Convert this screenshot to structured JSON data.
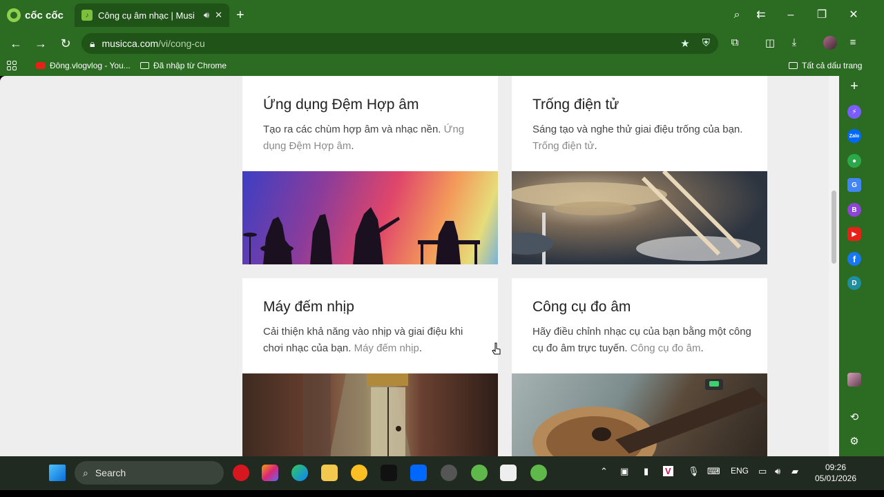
{
  "browser": {
    "brand": "cốc cốc",
    "tab_title": "Công cụ âm nhạc | Musi",
    "url_host": "musicca.com",
    "url_path": "/vi/cong-cu",
    "bookmarks": [
      {
        "label": "Đông.vlogvlog - You...",
        "icon": "youtube-icon"
      },
      {
        "label": "Đã nhập từ Chrome",
        "icon": "folder-icon"
      }
    ],
    "all_bookmarks": "Tất cả dấu trang"
  },
  "cards": [
    {
      "title": "Ứng dụng Đệm Hợp âm",
      "desc": "Tạo ra các chùm hợp âm và nhạc nền.",
      "link": "Ứng dụng Đệm Hợp âm"
    },
    {
      "title": "Trống điện tử",
      "desc": "Sáng tạo và nghe thử giai điệu trống của bạn.",
      "link": "Trống điện tử"
    },
    {
      "title": "Máy đếm nhịp",
      "desc": "Cải thiện khả năng vào nhịp và giai điệu khi chơi nhạc của bạn.",
      "link": "Máy đếm nhịp"
    },
    {
      "title": "Công cụ đo âm",
      "desc": "Hãy điều chỉnh nhạc cụ của bạn bằng một công cụ đo âm trực tuyến.",
      "link": "Công cụ đo âm"
    }
  ],
  "side_panel": [
    {
      "icon": "plus-icon"
    },
    {
      "icon": "messenger-icon",
      "color": "#7b5cff"
    },
    {
      "icon": "zalo-icon",
      "color": "#0068ff",
      "label": "Zalo"
    },
    {
      "icon": "game-icon",
      "color": "#2aa84a"
    },
    {
      "icon": "translate-icon",
      "color": "#4285f4"
    },
    {
      "icon": "b-icon",
      "color": "#8e44d6",
      "label": "B"
    },
    {
      "icon": "youtube-icon",
      "color": "#e62117"
    },
    {
      "icon": "facebook-icon",
      "color": "#1877f2",
      "label": "f"
    },
    {
      "icon": "d-icon",
      "color": "#1f8ea0",
      "label": "D"
    }
  ],
  "taskbar": {
    "search_placeholder": "Search",
    "language": "ENG",
    "time": "09:26",
    "date": "05/01/2026"
  }
}
